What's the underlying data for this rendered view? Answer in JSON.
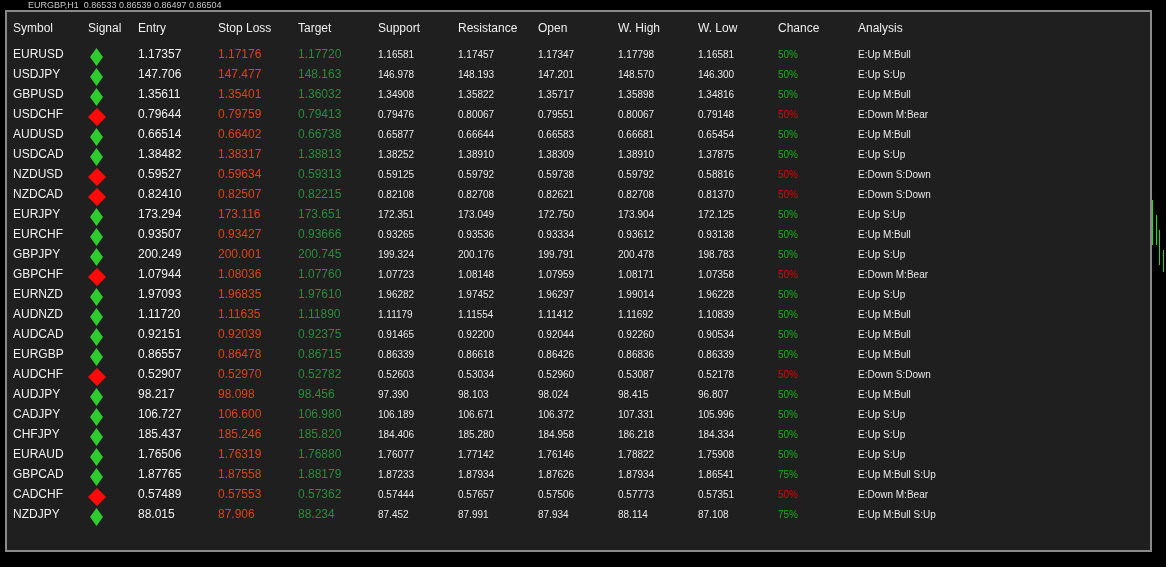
{
  "chart_header": "EURGBP,H1  0.86533 0.86539 0.86497 0.86504",
  "columns": [
    "Symbol",
    "Signal",
    "Entry",
    "Stop Loss",
    "Target",
    "Support",
    "Resistance",
    "Open",
    "W. High",
    "W. Low",
    "Chance",
    "Analysis"
  ],
  "rows": [
    {
      "symbol": "EURUSD",
      "kind": "buy",
      "entry": "1.17357",
      "stop_loss": "1.17176",
      "target": "1.17720",
      "support": "1.16581",
      "resistance": "1.17457",
      "open": "1.17347",
      "w_high": "1.17798",
      "w_low": "1.16581",
      "chance": "50%",
      "analysis": "E:Up M:Bull"
    },
    {
      "symbol": "USDJPY",
      "kind": "buy",
      "entry": "147.706",
      "stop_loss": "147.477",
      "target": "148.163",
      "support": "146.978",
      "resistance": "148.193",
      "open": "147.201",
      "w_high": "148.570",
      "w_low": "146.300",
      "chance": "50%",
      "analysis": "E:Up S:Up"
    },
    {
      "symbol": "GBPUSD",
      "kind": "buy",
      "entry": "1.35611",
      "stop_loss": "1.35401",
      "target": "1.36032",
      "support": "1.34908",
      "resistance": "1.35822",
      "open": "1.35717",
      "w_high": "1.35898",
      "w_low": "1.34816",
      "chance": "50%",
      "analysis": "E:Up M:Bull"
    },
    {
      "symbol": "USDCHF",
      "kind": "sell",
      "entry": "0.79644",
      "stop_loss": "0.79759",
      "target": "0.79413",
      "support": "0.79476",
      "resistance": "0.80067",
      "open": "0.79551",
      "w_high": "0.80067",
      "w_low": "0.79148",
      "chance": "50%",
      "analysis": "E:Down M:Bear"
    },
    {
      "symbol": "AUDUSD",
      "kind": "buy",
      "entry": "0.66514",
      "stop_loss": "0.66402",
      "target": "0.66738",
      "support": "0.65877",
      "resistance": "0.66644",
      "open": "0.66583",
      "w_high": "0.66681",
      "w_low": "0.65454",
      "chance": "50%",
      "analysis": "E:Up M:Bull"
    },
    {
      "symbol": "USDCAD",
      "kind": "buy",
      "entry": "1.38482",
      "stop_loss": "1.38317",
      "target": "1.38813",
      "support": "1.38252",
      "resistance": "1.38910",
      "open": "1.38309",
      "w_high": "1.38910",
      "w_low": "1.37875",
      "chance": "50%",
      "analysis": "E:Up S:Up"
    },
    {
      "symbol": "NZDUSD",
      "kind": "sell",
      "entry": "0.59527",
      "stop_loss": "0.59634",
      "target": "0.59313",
      "support": "0.59125",
      "resistance": "0.59792",
      "open": "0.59738",
      "w_high": "0.59792",
      "w_low": "0.58816",
      "chance": "50%",
      "analysis": "E:Down S:Down"
    },
    {
      "symbol": "NZDCAD",
      "kind": "sell",
      "entry": "0.82410",
      "stop_loss": "0.82507",
      "target": "0.82215",
      "support": "0.82108",
      "resistance": "0.82708",
      "open": "0.82621",
      "w_high": "0.82708",
      "w_low": "0.81370",
      "chance": "50%",
      "analysis": "E:Down S:Down"
    },
    {
      "symbol": "EURJPY",
      "kind": "buy",
      "entry": "173.294",
      "stop_loss": "173.116",
      "target": "173.651",
      "support": "172.351",
      "resistance": "173.049",
      "open": "172.750",
      "w_high": "173.904",
      "w_low": "172.125",
      "chance": "50%",
      "analysis": "E:Up S:Up"
    },
    {
      "symbol": "EURCHF",
      "kind": "buy",
      "entry": "0.93507",
      "stop_loss": "0.93427",
      "target": "0.93666",
      "support": "0.93265",
      "resistance": "0.93536",
      "open": "0.93334",
      "w_high": "0.93612",
      "w_low": "0.93138",
      "chance": "50%",
      "analysis": "E:Up M:Bull"
    },
    {
      "symbol": "GBPJPY",
      "kind": "buy",
      "entry": "200.249",
      "stop_loss": "200.001",
      "target": "200.745",
      "support": "199.324",
      "resistance": "200.176",
      "open": "199.791",
      "w_high": "200.478",
      "w_low": "198.783",
      "chance": "50%",
      "analysis": "E:Up S:Up"
    },
    {
      "symbol": "GBPCHF",
      "kind": "sell",
      "entry": "1.07944",
      "stop_loss": "1.08036",
      "target": "1.07760",
      "support": "1.07723",
      "resistance": "1.08148",
      "open": "1.07959",
      "w_high": "1.08171",
      "w_low": "1.07358",
      "chance": "50%",
      "analysis": "E:Down M:Bear"
    },
    {
      "symbol": "EURNZD",
      "kind": "buy",
      "entry": "1.97093",
      "stop_loss": "1.96835",
      "target": "1.97610",
      "support": "1.96282",
      "resistance": "1.97452",
      "open": "1.96297",
      "w_high": "1.99014",
      "w_low": "1.96228",
      "chance": "50%",
      "analysis": "E:Up S:Up"
    },
    {
      "symbol": "AUDNZD",
      "kind": "buy",
      "entry": "1.11720",
      "stop_loss": "1.11635",
      "target": "1.11890",
      "support": "1.11179",
      "resistance": "1.11554",
      "open": "1.11412",
      "w_high": "1.11692",
      "w_low": "1.10839",
      "chance": "50%",
      "analysis": "E:Up M:Bull"
    },
    {
      "symbol": "AUDCAD",
      "kind": "buy",
      "entry": "0.92151",
      "stop_loss": "0.92039",
      "target": "0.92375",
      "support": "0.91465",
      "resistance": "0.92200",
      "open": "0.92044",
      "w_high": "0.92260",
      "w_low": "0.90534",
      "chance": "50%",
      "analysis": "E:Up M:Bull"
    },
    {
      "symbol": "EURGBP",
      "kind": "buy",
      "entry": "0.86557",
      "stop_loss": "0.86478",
      "target": "0.86715",
      "support": "0.86339",
      "resistance": "0.86618",
      "open": "0.86426",
      "w_high": "0.86836",
      "w_low": "0.86339",
      "chance": "50%",
      "analysis": "E:Up M:Bull"
    },
    {
      "symbol": "AUDCHF",
      "kind": "sell",
      "entry": "0.52907",
      "stop_loss": "0.52970",
      "target": "0.52782",
      "support": "0.52603",
      "resistance": "0.53034",
      "open": "0.52960",
      "w_high": "0.53087",
      "w_low": "0.52178",
      "chance": "50%",
      "analysis": "E:Down S:Down"
    },
    {
      "symbol": "AUDJPY",
      "kind": "buy",
      "entry": "98.217",
      "stop_loss": "98.098",
      "target": "98.456",
      "support": "97.390",
      "resistance": "98.103",
      "open": "98.024",
      "w_high": "98.415",
      "w_low": "96.807",
      "chance": "50%",
      "analysis": "E:Up M:Bull"
    },
    {
      "symbol": "CADJPY",
      "kind": "buy",
      "entry": "106.727",
      "stop_loss": "106.600",
      "target": "106.980",
      "support": "106.189",
      "resistance": "106.671",
      "open": "106.372",
      "w_high": "107.331",
      "w_low": "105.996",
      "chance": "50%",
      "analysis": "E:Up S:Up"
    },
    {
      "symbol": "CHFJPY",
      "kind": "buy",
      "entry": "185.437",
      "stop_loss": "185.246",
      "target": "185.820",
      "support": "184.406",
      "resistance": "185.280",
      "open": "184.958",
      "w_high": "186.218",
      "w_low": "184.334",
      "chance": "50%",
      "analysis": "E:Up S:Up"
    },
    {
      "symbol": "EURAUD",
      "kind": "buy",
      "entry": "1.76506",
      "stop_loss": "1.76319",
      "target": "1.76880",
      "support": "1.76077",
      "resistance": "1.77142",
      "open": "1.76146",
      "w_high": "1.78822",
      "w_low": "1.75908",
      "chance": "50%",
      "analysis": "E:Up S:Up"
    },
    {
      "symbol": "GBPCAD",
      "kind": "buy",
      "entry": "1.87765",
      "stop_loss": "1.87558",
      "target": "1.88179",
      "support": "1.87233",
      "resistance": "1.87934",
      "open": "1.87626",
      "w_high": "1.87934",
      "w_low": "1.86541",
      "chance": "75%",
      "analysis": "E:Up M:Bull S:Up"
    },
    {
      "symbol": "CADCHF",
      "kind": "sell",
      "entry": "0.57489",
      "stop_loss": "0.57553",
      "target": "0.57362",
      "support": "0.57444",
      "resistance": "0.57657",
      "open": "0.57506",
      "w_high": "0.57773",
      "w_low": "0.57351",
      "chance": "50%",
      "analysis": "E:Down M:Bear"
    },
    {
      "symbol": "NZDJPY",
      "kind": "buy",
      "entry": "88.015",
      "stop_loss": "87.906",
      "target": "88.234",
      "support": "87.452",
      "resistance": "87.991",
      "open": "87.934",
      "w_high": "88.114",
      "w_low": "87.108",
      "chance": "75%",
      "analysis": "E:Up M:Bull S:Up"
    }
  ]
}
